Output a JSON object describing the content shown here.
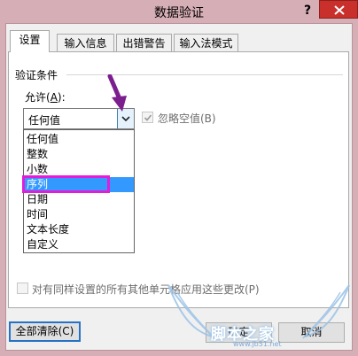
{
  "window": {
    "title": "数据验证",
    "help_label": "?"
  },
  "tabs": [
    {
      "label": "设置",
      "active": true
    },
    {
      "label": "输入信息",
      "active": false
    },
    {
      "label": "出错警告",
      "active": false
    },
    {
      "label": "输入法模式",
      "active": false
    }
  ],
  "validation": {
    "group_label": "验证条件",
    "allow_label_prefix": "允许(",
    "allow_label_key": "A",
    "allow_label_suffix": "):",
    "allow_value": "任何值",
    "ignore_blank_label": "忽略空值(B)",
    "ignore_blank_checked": true,
    "ignore_blank_enabled": false
  },
  "dropdown": {
    "options": [
      "任何值",
      "整数",
      "小数",
      "序列",
      "日期",
      "时间",
      "文本长度",
      "自定义"
    ],
    "highlighted": "序列"
  },
  "apply_all": {
    "label": "对有同样设置的所有其他单元格应用这些更改(P)",
    "checked": false,
    "enabled": false
  },
  "buttons": {
    "clear_all": "全部清除(C)",
    "ok": "确定",
    "cancel": "取消"
  },
  "watermark": {
    "text": "脚本之家",
    "url": "www.jb51.net"
  },
  "colors": {
    "titlebar": "#d6aeb6",
    "close_button": "#c9302c",
    "selection": "#3399ff",
    "annotation_box": "#e31cd8",
    "annotation_arrow": "#7b1f8f"
  }
}
